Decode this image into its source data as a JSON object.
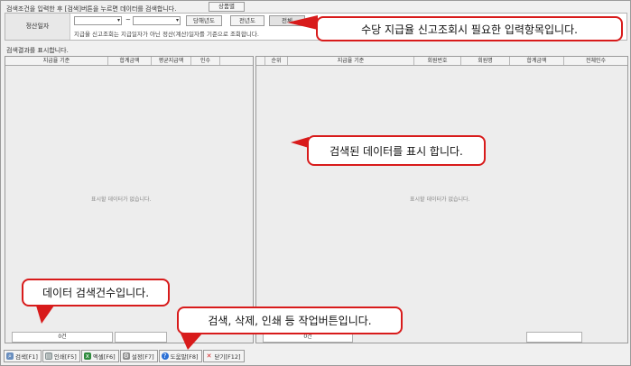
{
  "top_hint": "검색조건을 입력한 후 [검색]버튼을 누르면 데이터를 검색합니다.",
  "tag_button": "상품별",
  "search": {
    "label": "정산일자",
    "tilde": "~",
    "buttons": [
      "당해년도",
      "전년도",
      "전체"
    ],
    "note": "지급율 신고조회는 지급일자가 아닌 정산(계산)일자를 기준으로 조회합니다."
  },
  "results_title": "검색결과를 표시합니다.",
  "left_grid": {
    "columns": [
      "지급율 기준",
      "합계금액",
      "평균지급액",
      "인수"
    ],
    "empty": "표시할 데이터가 없습니다.",
    "count": "0건"
  },
  "right_grid": {
    "columns": [
      "순위",
      "지급율 기준",
      "회원번호",
      "회원명",
      "합계금액",
      "전체인수"
    ],
    "empty": "표시할 데이터가 없습니다.",
    "count": "0건"
  },
  "toolbar": [
    {
      "label": "검색[F1]",
      "icon": "search-icon",
      "color": "#6a8fbf"
    },
    {
      "label": "인쇄[F5]",
      "icon": "print-icon",
      "color": "#7f8c8d"
    },
    {
      "label": "엑셀[F6]",
      "icon": "excel-icon",
      "color": "#2e8b3d"
    },
    {
      "label": "설정[F7]",
      "icon": "settings-icon",
      "color": "#8d8d8d"
    },
    {
      "label": "도움말[F8]",
      "icon": "help-icon",
      "color": "#2a6fd6"
    },
    {
      "label": "닫기[F12]",
      "icon": "close-icon",
      "color": "#d32020"
    }
  ],
  "callouts": {
    "input_items": "수당 지급율 신고조회시 필요한 입력항목입니다.",
    "data_display": "검색된 데이터를 표시 합니다.",
    "count_info": "데이터 검색건수입니다.",
    "action_buttons": "검색, 삭제, 인쇄  등 작업버튼입니다."
  },
  "colors": {
    "callout_border": "#d81b1b"
  }
}
